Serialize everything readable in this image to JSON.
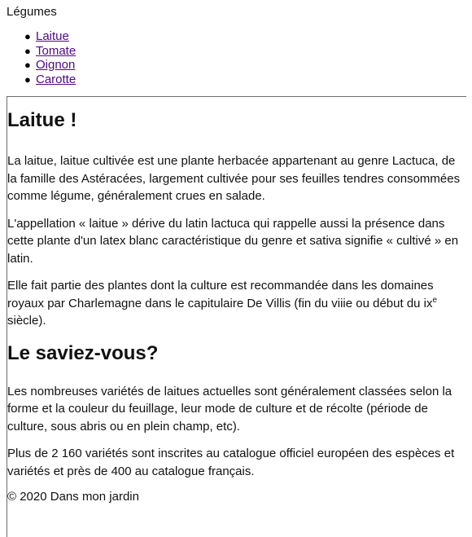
{
  "nav": {
    "title": "Légumes",
    "items": [
      {
        "label": "Laitue"
      },
      {
        "label": "Tomate"
      },
      {
        "label": "Oignon"
      },
      {
        "label": "Carotte"
      }
    ]
  },
  "article": {
    "heading": "Laitue !",
    "paragraphs": [
      "La laitue, laitue cultivée est une plante herbacée appartenant au genre Lactuca, de la famille des Astéracées, largement cultivée pour ses feuilles tendres consommées comme légume, généralement crues en salade.",
      "L'appellation « laitue » dérive du latin lactuca qui rappelle aussi la présence dans cette plante d'un latex blanc caractéristique du genre et sativa signifie « cultivé » en latin."
    ],
    "p3_before_sup": "Elle fait partie des plantes dont la culture est recommandée dans les domaines royaux par Charlemagne dans le capitulaire De Villis (fin du viiie ou début du ix",
    "p3_sup": "e",
    "p3_after_sup": " siècle).",
    "subheading": "Le saviez-vous?",
    "facts": [
      "Les nombreuses variétés de laitues actuelles sont généralement classées selon la forme et la couleur du feuillage, leur mode de culture et de récolte (période de culture, sous abris ou en plein champ, etc).",
      "Plus de 2 160 variétés sont inscrites au catalogue officiel européen des espèces et variétés et près de 400 au catalogue français."
    ]
  },
  "footer": {
    "text": "© 2020 Dans mon jardin"
  },
  "colors": {
    "link": "#4b0a86",
    "text": "#111111",
    "border": "#6b6b6b"
  }
}
